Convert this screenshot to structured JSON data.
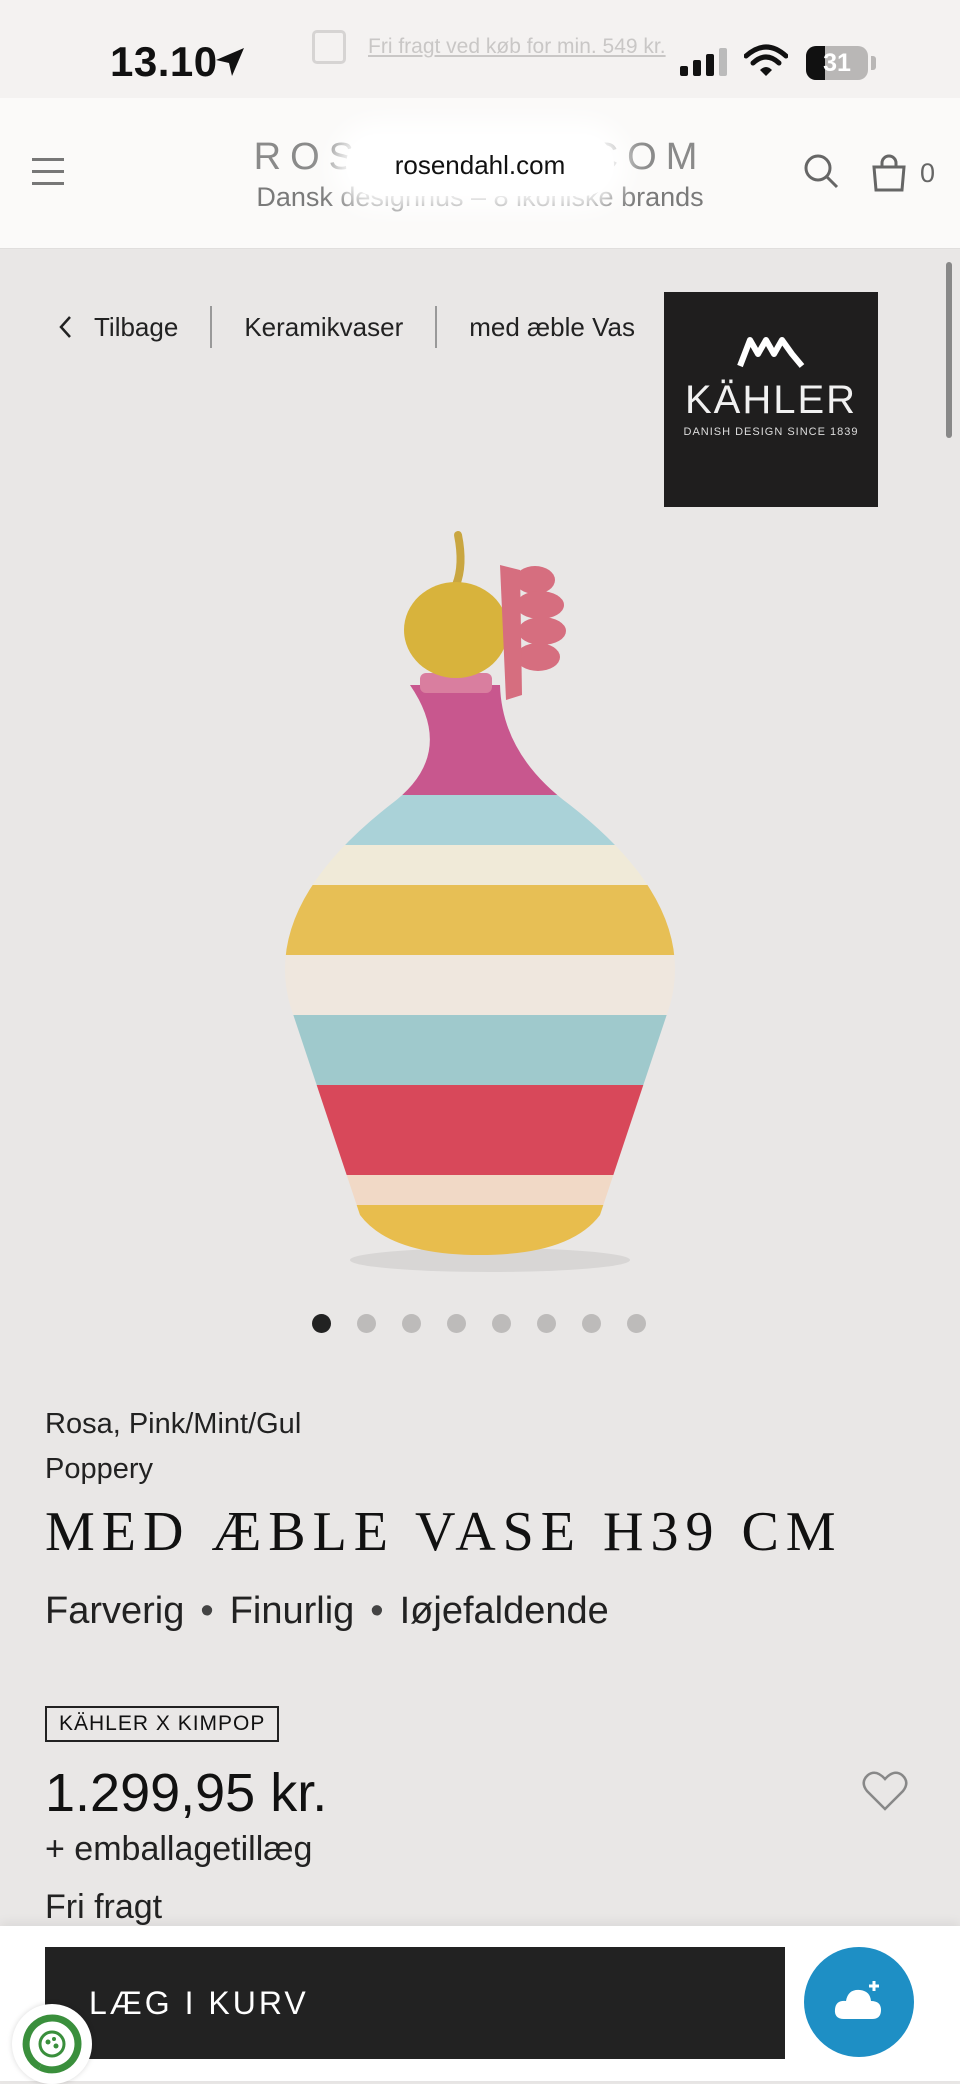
{
  "status_bar": {
    "time": "13.10",
    "battery": "31",
    "battery_level": 0.31,
    "promo": "Fri fragt ved køb for min. 549 kr."
  },
  "header": {
    "brand": "ROSENDAHL.COM",
    "tagline": "Dansk designhus – 8 ikoniske brands",
    "url": "rosendahl.com",
    "cart_count": "0"
  },
  "breadcrumbs": {
    "back": "Tilbage",
    "items": [
      "Keramikvaser",
      "med æble Vas"
    ]
  },
  "brand_logo": {
    "name": "KÄHLER",
    "since": "DANISH DESIGN SINCE 1839"
  },
  "gallery": {
    "total": 8,
    "active_index": 0
  },
  "product": {
    "color": "Rosa, Pink/Mint/Gul",
    "designer": "Poppery",
    "title": "MED ÆBLE VASE H39 CM",
    "traits": [
      "Farverig",
      "Finurlig",
      "Iøjefaldende"
    ],
    "badge": "KÄHLER X KIMPOP",
    "price": "1.299,95 kr.",
    "fee": "+ emballagetillæg",
    "shipping": "Fri fragt"
  },
  "actions": {
    "add_to_cart": "LÆG I KURV"
  },
  "colors": {
    "button_dark": "#222222",
    "chat_blue": "#1e8fc5",
    "background": "#e9e7e6"
  },
  "icons": [
    "location-arrow-icon",
    "signal-icon",
    "wifi-icon",
    "menu-icon",
    "search-icon",
    "cart-icon",
    "chevron-left-icon",
    "heart-icon",
    "chat-cloud-icon",
    "recycle-icon"
  ]
}
